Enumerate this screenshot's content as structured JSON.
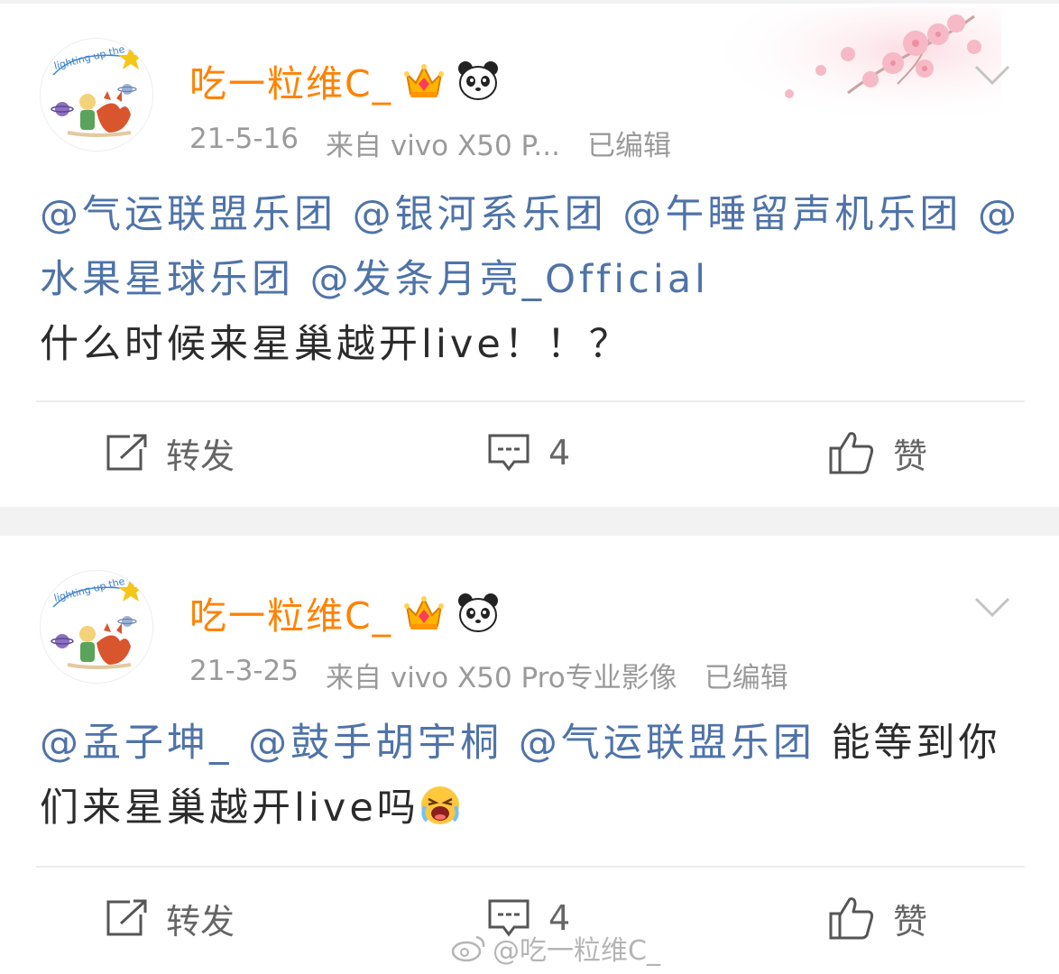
{
  "posts": [
    {
      "username": "吃一粒维C_",
      "date": "21-5-16",
      "source": "来自 vivo X50 P...",
      "edited": "已编辑",
      "mentions": [
        "@气运联盟乐团",
        "@银河系乐团",
        "@午睡留声机乐团",
        "@水果星球乐团",
        "@发条月亮_Official"
      ],
      "text": "什么时候来星巢越开live！！？",
      "actions": {
        "repost": "转发",
        "comment": "4",
        "like": "赞"
      }
    },
    {
      "username": "吃一粒维C_",
      "date": "21-3-25",
      "source": "来自 vivo X50 Pro专业影像",
      "edited": "已编辑",
      "mentions": [
        "@孟子坤_",
        "@鼓手胡宇桐",
        "@气运联盟乐团"
      ],
      "text": "能等到你们来星巢越开live吗",
      "actions": {
        "repost": "转发",
        "comment": "4",
        "like": "赞"
      }
    }
  ],
  "avatar_text": "lighting up the stars",
  "watermark": "@吃一粒维C_",
  "colors": {
    "username": "#ff8200",
    "mention": "#4f73a8",
    "meta": "#9a9a9a",
    "text": "#2b2b2b",
    "background": "#f2f2f2"
  },
  "icons": [
    "crown-vip-icon",
    "panda-icon",
    "chevron-down-icon",
    "repost-icon",
    "comment-icon",
    "like-icon",
    "crying-emoji-icon",
    "weibo-logo-icon"
  ]
}
